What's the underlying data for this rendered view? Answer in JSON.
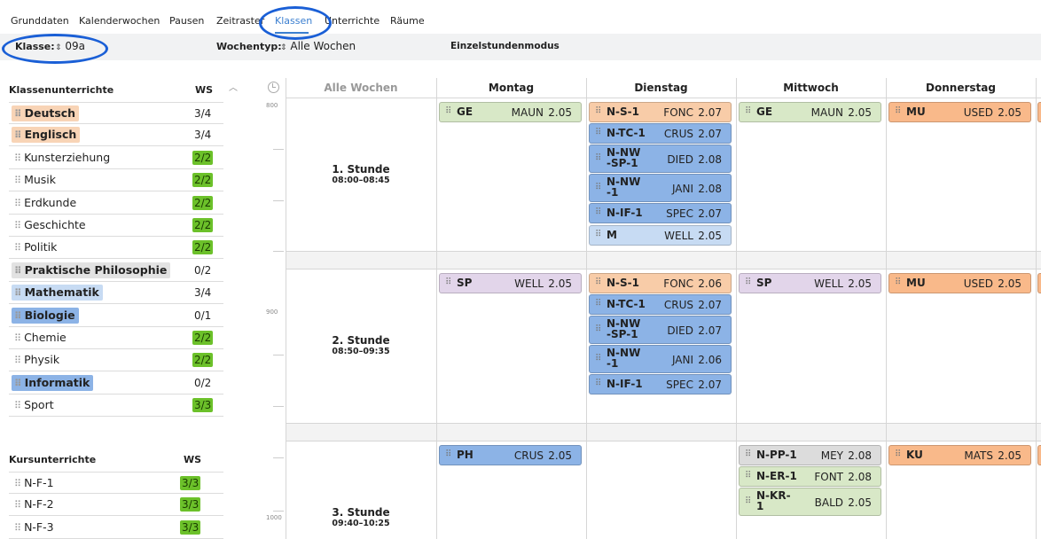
{
  "tabs": [
    "Grunddaten",
    "Kalenderwochen",
    "Pausen",
    "Zeitraster",
    "Klassen",
    "Unterrichte",
    "Räume"
  ],
  "active_tab": "Klassen",
  "filter": {
    "klasse_label": "Klasse:",
    "klasse_value": "09a",
    "wochentyp_label": "Wochentyp:",
    "wochentyp_value": "Alle Wochen",
    "mode_label": "Einzelstundenmodus"
  },
  "klassenunterrichte": {
    "header": "Klassenunterrichte",
    "ws_header": "WS",
    "items": [
      {
        "label": "Deutsch",
        "ws": "3/4",
        "bold": true,
        "color": "#f8d4b6",
        "ok": false
      },
      {
        "label": "Englisch",
        "ws": "3/4",
        "bold": true,
        "color": "#f8d4b6",
        "ok": false
      },
      {
        "label": "Kunsterziehung",
        "ws": "2/2",
        "bold": false,
        "color": "",
        "ok": true
      },
      {
        "label": "Musik",
        "ws": "2/2",
        "bold": false,
        "color": "",
        "ok": true
      },
      {
        "label": "Erdkunde",
        "ws": "2/2",
        "bold": false,
        "color": "",
        "ok": true
      },
      {
        "label": "Geschichte",
        "ws": "2/2",
        "bold": false,
        "color": "",
        "ok": true
      },
      {
        "label": "Politik",
        "ws": "2/2",
        "bold": false,
        "color": "",
        "ok": true
      },
      {
        "label": "Praktische Philosophie",
        "ws": "0/2",
        "bold": true,
        "color": "#e2e2e2",
        "ok": false
      },
      {
        "label": "Mathematik",
        "ws": "3/4",
        "bold": true,
        "color": "#c7dbf3",
        "ok": false
      },
      {
        "label": "Biologie",
        "ws": "0/1",
        "bold": true,
        "color": "#8cb3e6",
        "ok": false
      },
      {
        "label": "Chemie",
        "ws": "2/2",
        "bold": false,
        "color": "",
        "ok": true
      },
      {
        "label": "Physik",
        "ws": "2/2",
        "bold": false,
        "color": "",
        "ok": true
      },
      {
        "label": "Informatik",
        "ws": "0/2",
        "bold": true,
        "color": "#8cb3e6",
        "ok": false
      },
      {
        "label": "Sport",
        "ws": "3/3",
        "bold": false,
        "color": "",
        "ok": true
      }
    ]
  },
  "kursunterrichte": {
    "header": "Kursunterrichte",
    "ws_header": "WS",
    "items": [
      {
        "label": "N-F-1",
        "ws": "3/3",
        "ok": true
      },
      {
        "label": "N-F-2",
        "ws": "3/3",
        "ok": true
      },
      {
        "label": "N-F-3",
        "ws": "3/3",
        "ok": true
      }
    ]
  },
  "timetable": {
    "week_label": "Alle Wochen",
    "days": [
      "Montag",
      "Dienstag",
      "Mittwoch",
      "Donnerstag"
    ],
    "time_ticks": [
      "800",
      "900",
      "1000"
    ],
    "periods": [
      {
        "name": "1. Stunde",
        "time": "08:00–08:45"
      },
      {
        "name": "2. Stunde",
        "time": "08:50–09:35"
      },
      {
        "name": "3. Stunde",
        "time": "09:40–10:25"
      }
    ],
    "lessons": [
      {
        "period": 0,
        "day": 0,
        "slot": 0,
        "name": "GE",
        "teacher": "MAUN",
        "room": "2.05",
        "color": "green"
      },
      {
        "period": 0,
        "day": 1,
        "slot": 0,
        "name": "N-S-1",
        "teacher": "FONC",
        "room": "2.07",
        "color": "orange"
      },
      {
        "period": 0,
        "day": 1,
        "slot": 1,
        "name": "N-TC-1",
        "teacher": "CRUS",
        "room": "2.07",
        "color": "blue"
      },
      {
        "period": 0,
        "day": 1,
        "slot": 2,
        "name": "N-NW-SP-1",
        "teacher": "DIED",
        "room": "2.08",
        "color": "blue"
      },
      {
        "period": 0,
        "day": 1,
        "slot": 3,
        "name": "N-NW-1",
        "teacher": "JANI",
        "room": "2.08",
        "color": "blue"
      },
      {
        "period": 0,
        "day": 1,
        "slot": 4,
        "name": "N-IF-1",
        "teacher": "SPEC",
        "room": "2.07",
        "color": "blue"
      },
      {
        "period": 0,
        "day": 1,
        "slot": 5,
        "name": "M",
        "teacher": "WELL",
        "room": "2.05",
        "color": "lblue"
      },
      {
        "period": 0,
        "day": 2,
        "slot": 0,
        "name": "GE",
        "teacher": "MAUN",
        "room": "2.05",
        "color": "green"
      },
      {
        "period": 0,
        "day": 3,
        "slot": 0,
        "name": "MU",
        "teacher": "USED",
        "room": "2.05",
        "color": "morange"
      },
      {
        "period": 1,
        "day": 0,
        "slot": 0,
        "name": "SP",
        "teacher": "WELL",
        "room": "2.05",
        "color": "purple"
      },
      {
        "period": 1,
        "day": 1,
        "slot": 0,
        "name": "N-S-1",
        "teacher": "FONC",
        "room": "2.06",
        "color": "orange"
      },
      {
        "period": 1,
        "day": 1,
        "slot": 1,
        "name": "N-TC-1",
        "teacher": "CRUS",
        "room": "2.07",
        "color": "blue"
      },
      {
        "period": 1,
        "day": 1,
        "slot": 2,
        "name": "N-NW-SP-1",
        "teacher": "DIED",
        "room": "2.07",
        "color": "blue"
      },
      {
        "period": 1,
        "day": 1,
        "slot": 3,
        "name": "N-NW-1",
        "teacher": "JANI",
        "room": "2.06",
        "color": "blue"
      },
      {
        "period": 1,
        "day": 1,
        "slot": 4,
        "name": "N-IF-1",
        "teacher": "SPEC",
        "room": "2.07",
        "color": "blue"
      },
      {
        "period": 1,
        "day": 2,
        "slot": 0,
        "name": "SP",
        "teacher": "WELL",
        "room": "2.05",
        "color": "purple"
      },
      {
        "period": 1,
        "day": 3,
        "slot": 0,
        "name": "MU",
        "teacher": "USED",
        "room": "2.05",
        "color": "morange"
      },
      {
        "period": 2,
        "day": 0,
        "slot": 0,
        "name": "PH",
        "teacher": "CRUS",
        "room": "2.05",
        "color": "blue"
      },
      {
        "period": 2,
        "day": 2,
        "slot": 0,
        "name": "N-PP-1",
        "teacher": "MEY",
        "room": "2.08",
        "color": "gray"
      },
      {
        "period": 2,
        "day": 2,
        "slot": 1,
        "name": "N-ER-1",
        "teacher": "FONT",
        "room": "2.08",
        "color": "green"
      },
      {
        "period": 2,
        "day": 2,
        "slot": 2,
        "name": "N-KR-1",
        "teacher": "BALD",
        "room": "2.05",
        "color": "green"
      },
      {
        "period": 2,
        "day": 3,
        "slot": 0,
        "name": "KU",
        "teacher": "MATS",
        "room": "2.05",
        "color": "morange"
      }
    ]
  }
}
